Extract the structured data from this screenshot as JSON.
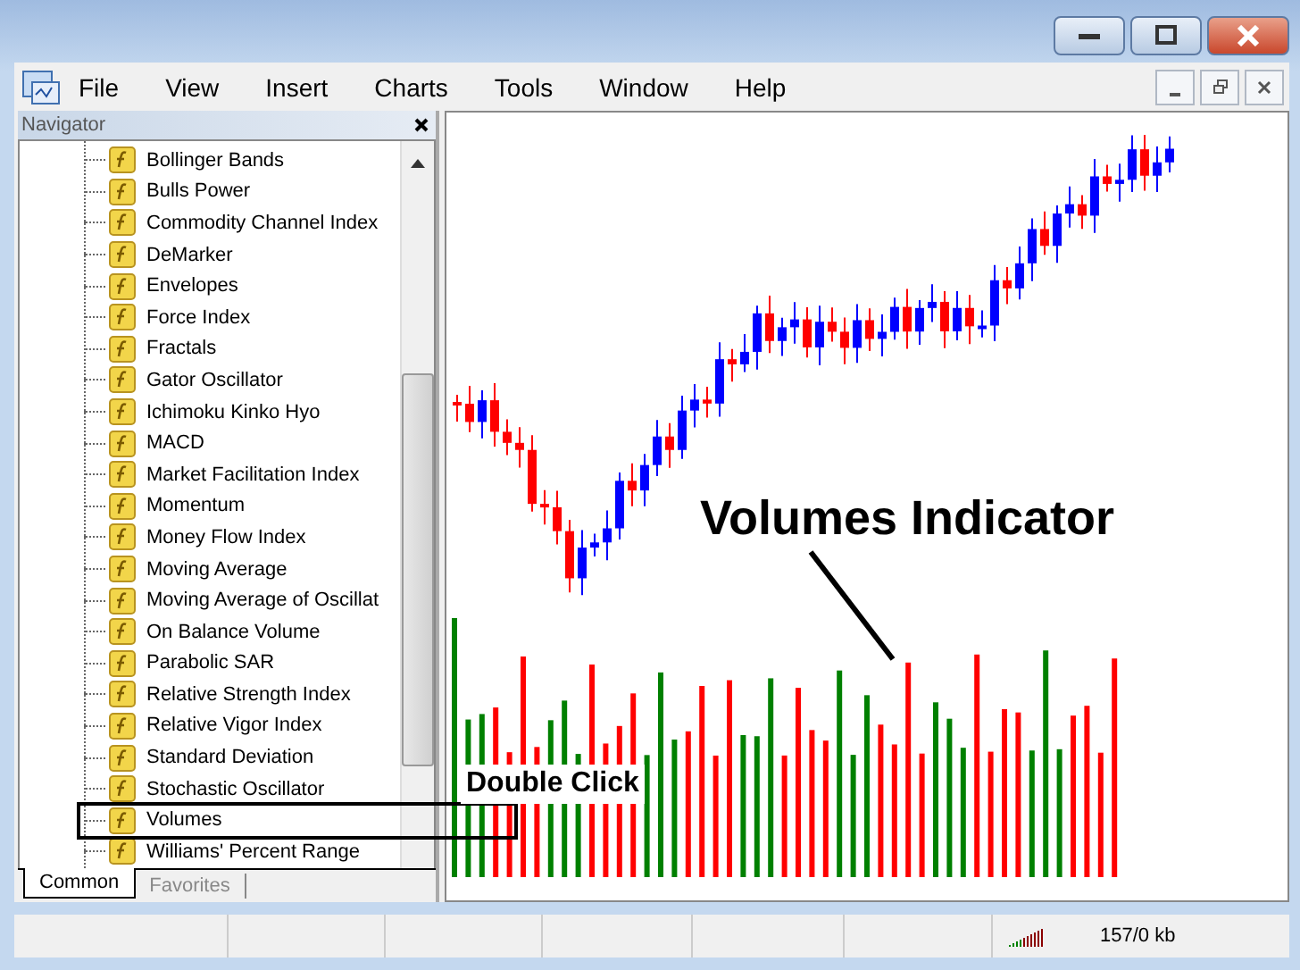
{
  "menu": [
    "File",
    "View",
    "Insert",
    "Charts",
    "Tools",
    "Window",
    "Help"
  ],
  "navigator": {
    "title": "Navigator",
    "items": [
      "Bollinger Bands",
      "Bulls Power",
      "Commodity Channel Index",
      "DeMarker",
      "Envelopes",
      "Force Index",
      "Fractals",
      "Gator Oscillator",
      "Ichimoku Kinko Hyo",
      "MACD",
      "Market Facilitation Index",
      "Momentum",
      "Money Flow Index",
      "Moving Average",
      "Moving Average of Oscillat",
      "On Balance Volume",
      "Parabolic SAR",
      "Relative Strength Index",
      "Relative Vigor Index",
      "Standard Deviation",
      "Stochastic Oscillator",
      "Volumes",
      "Williams' Percent Range"
    ],
    "tabs": [
      {
        "label": "Common",
        "selected": true
      },
      {
        "label": "Favorites",
        "selected": false
      }
    ]
  },
  "annotations": {
    "callout": "Volumes Indicator",
    "instruction": "Double Click"
  },
  "status_bar": {
    "memory": "157/0 kb"
  }
}
